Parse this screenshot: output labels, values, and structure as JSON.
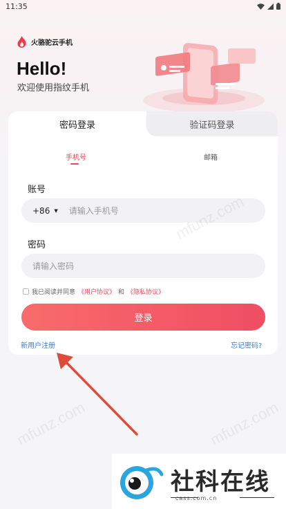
{
  "status": {
    "time": "11:35",
    "wifi_icon": "wifi-icon",
    "signal_icon": "signal-icon",
    "battery_icon": "battery-icon"
  },
  "brand": {
    "name": "火骆驼云手机",
    "logo_icon": "flame-icon"
  },
  "hero": {
    "title": "Hello!",
    "subtitle": "欢迎使用指纹手机"
  },
  "tabs": [
    {
      "label": "密码登录",
      "active": true
    },
    {
      "label": "验证码登录",
      "active": false
    }
  ],
  "subtabs": [
    {
      "label": "手机号",
      "active": true
    },
    {
      "label": "邮箱",
      "active": false
    }
  ],
  "account": {
    "label": "账号",
    "country_code": "+86",
    "placeholder": "请输入手机号"
  },
  "password": {
    "label": "密码",
    "placeholder": "请输入密码"
  },
  "agreement": {
    "prefix": "我已阅读并同意",
    "user_terms": "《用户协议》",
    "conj": "和",
    "privacy": "《隐私协议》"
  },
  "login_label": "登录",
  "register_label": "新用户注册",
  "forgot_label": "忘记密码?",
  "watermark_text": "mfunz.com",
  "footer": {
    "title": "社科在线",
    "domain": "cass.com.cn"
  },
  "colors": {
    "accent": "#ee4458",
    "link": "#3a7bd5",
    "button_start": "#f86b6b",
    "button_end": "#f04e63",
    "arrow": "#e04a3a"
  }
}
